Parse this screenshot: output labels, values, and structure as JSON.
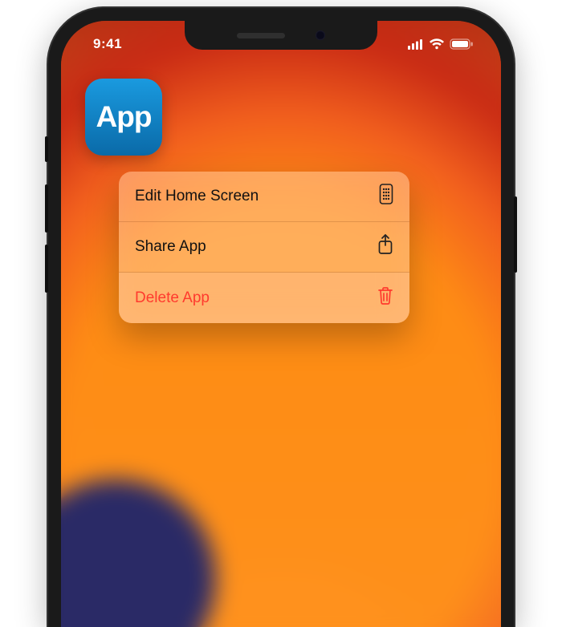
{
  "statusbar": {
    "time": "9:41"
  },
  "app": {
    "label": "App"
  },
  "menu": {
    "edit": {
      "label": "Edit Home Screen"
    },
    "share": {
      "label": "Share App"
    },
    "delete": {
      "label": "Delete App"
    }
  },
  "colors": {
    "destructive": "#ff3a2e"
  }
}
